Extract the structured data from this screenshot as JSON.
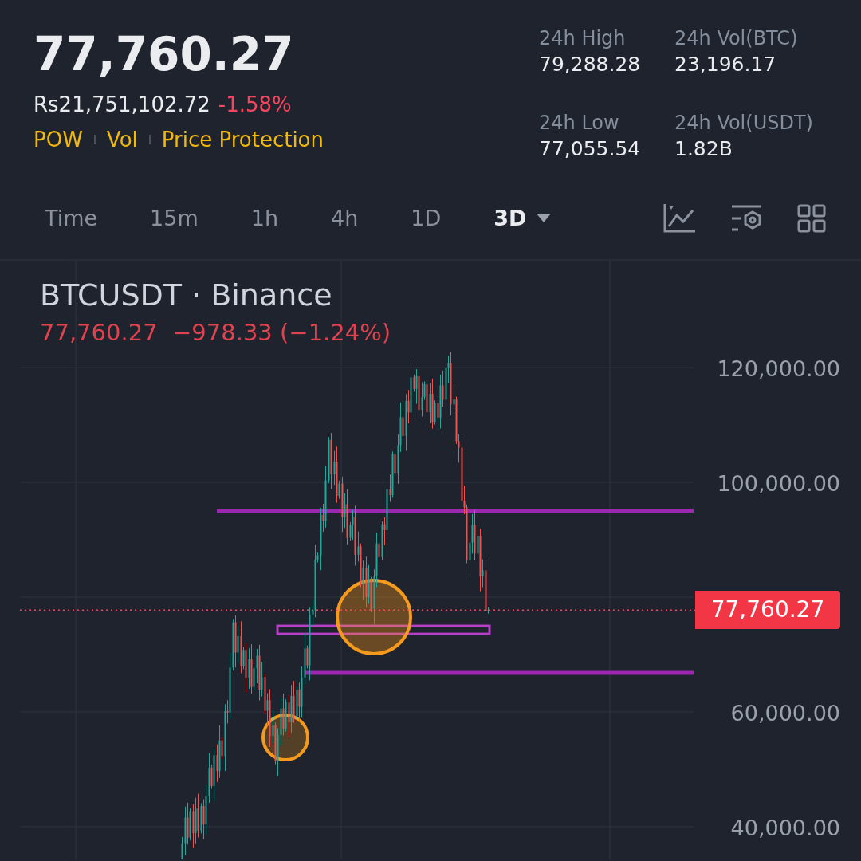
{
  "ticker": {
    "price": "77,760.27",
    "fiat_price": "Rs21,751,102.72",
    "change": "-1.58%",
    "tags": [
      "POW",
      "Vol",
      "Price Protection"
    ]
  },
  "stats": [
    {
      "label": "24h High",
      "value": "79,288.28"
    },
    {
      "label": "24h Vol(BTC)",
      "value": "23,196.17"
    },
    {
      "label": "24h Low",
      "value": "77,055.54"
    },
    {
      "label": "24h Vol(USDT)",
      "value": "1.82B"
    }
  ],
  "intervals": [
    {
      "label": "Time",
      "selected": false
    },
    {
      "label": "15m",
      "selected": false
    },
    {
      "label": "1h",
      "selected": false
    },
    {
      "label": "4h",
      "selected": false
    },
    {
      "label": "1D",
      "selected": false
    },
    {
      "label": "3D",
      "selected": true
    }
  ],
  "chart": {
    "symbol": "BTCUSDT · Binance",
    "quote": "77,760.27  −978.33 (−1.24%)",
    "last_price": "77,760.27",
    "price_axis": [
      "120,000.00",
      "100,000.00",
      "60,000.00",
      "40,000.00"
    ]
  }
}
